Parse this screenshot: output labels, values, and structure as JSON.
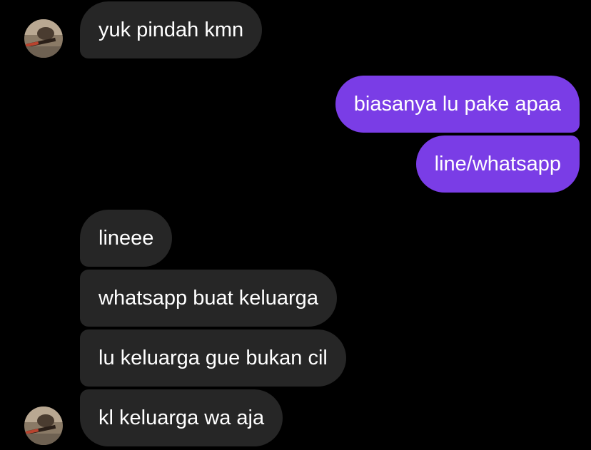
{
  "thread": {
    "colors": {
      "background": "#000000",
      "incoming_bubble": "#262626",
      "outgoing_bubble": "#7a3de6",
      "text": "#ffffff"
    },
    "avatar_icon": "user-avatar-photo",
    "messages": [
      {
        "sender": "them",
        "text": "yuk pindah kmn"
      },
      {
        "sender": "me",
        "text": "biasanya lu pake apaa"
      },
      {
        "sender": "me",
        "text": "line/whatsapp"
      },
      {
        "sender": "them",
        "text": "lineee"
      },
      {
        "sender": "them",
        "text": "whatsapp buat keluarga"
      },
      {
        "sender": "them",
        "text": "lu keluarga gue bukan cil"
      },
      {
        "sender": "them",
        "text": "kl keluarga wa aja"
      }
    ]
  }
}
